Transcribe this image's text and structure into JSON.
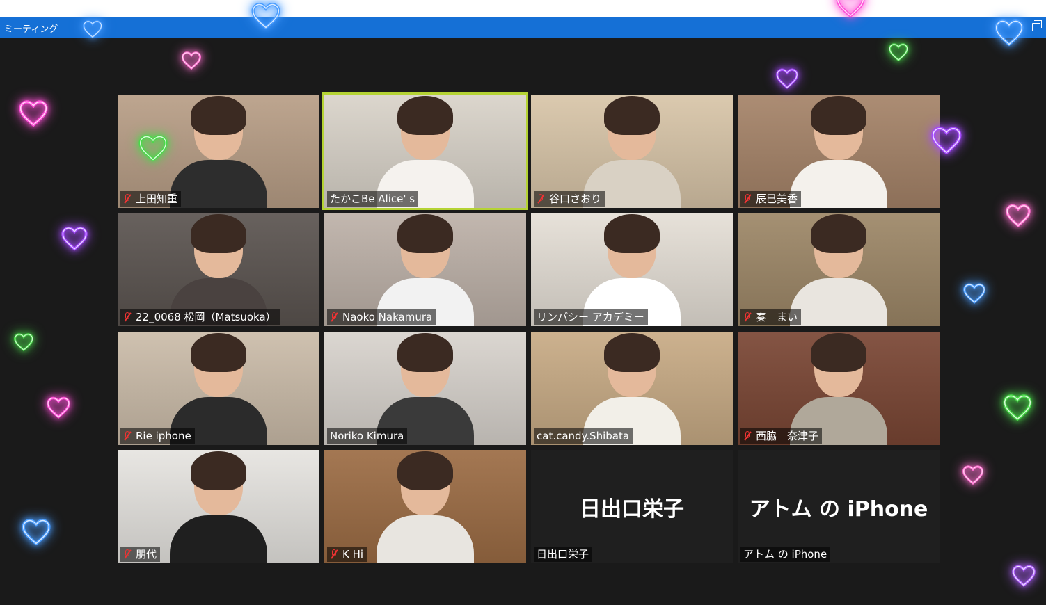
{
  "window": {
    "title": "ミーティング"
  },
  "participants": [
    {
      "name": "上田知重",
      "muted": true,
      "bg": "#b89e86",
      "shirt": "#2d2d2d",
      "active": false
    },
    {
      "name": "たかこBe Alice' s",
      "muted": false,
      "bg": "#d9d3c9",
      "shirt": "#f5f2ee",
      "active": true
    },
    {
      "name": "谷口さおり",
      "muted": true,
      "bg": "#d8c5a8",
      "shirt": "#d9d1c4",
      "active": false
    },
    {
      "name": "辰巳美香",
      "muted": true,
      "bg": "#a58368",
      "shirt": "#f4f1ec",
      "active": false
    },
    {
      "name": "22_0068 松岡（Matsuoka）",
      "muted": true,
      "bg": "#5b5450",
      "shirt": "#4a4240",
      "active": false
    },
    {
      "name": "Naoko Nakamura",
      "muted": true,
      "bg": "#bdb1a8",
      "shirt": "#f2f2f2",
      "active": false
    },
    {
      "name": "リンパシー アカデミー",
      "muted": false,
      "bg": "#e5dfd6",
      "shirt": "#ffffff",
      "active": false
    },
    {
      "name": "秦　まい",
      "muted": true,
      "bg": "#9d8767",
      "shirt": "#e9e5df",
      "active": false
    },
    {
      "name": "Rie iphone",
      "muted": true,
      "bg": "#cbbca9",
      "shirt": "#2b2b2b",
      "active": false
    },
    {
      "name": "Noriko Kimura",
      "muted": false,
      "bg": "#d8d3cd",
      "shirt": "#3a3a3a",
      "active": false
    },
    {
      "name": "cat.candy.Shibata",
      "muted": false,
      "bg": "#c8ab85",
      "shirt": "#f2efe8",
      "active": false
    },
    {
      "name": "西脇　奈津子",
      "muted": true,
      "bg": "#7a4634",
      "shirt": "#b0a89a",
      "active": false
    },
    {
      "name": "朋代",
      "muted": true,
      "bg": "#e6e4e0",
      "shirt": "#1f1f1f",
      "active": false
    },
    {
      "name": "K Hi",
      "muted": true,
      "bg": "#9c6c44",
      "shirt": "#e8e5e0",
      "active": false
    },
    {
      "name": "日出口栄子",
      "muted": false,
      "bg": "#1f1f1f",
      "shirt": "",
      "active": false,
      "video_off": true,
      "display_name": "日出口栄子"
    },
    {
      "name": "アトム の iPhone",
      "muted": false,
      "bg": "#1f1f1f",
      "shirt": "",
      "active": false,
      "video_off": true,
      "display_name": "アトム の iPhone"
    }
  ],
  "decorations": {
    "heart_colors": [
      "#ff4fd8",
      "#a64bff",
      "#4ad94a",
      "#4a9dff",
      "#ff6fd0",
      "#b060ff"
    ]
  }
}
